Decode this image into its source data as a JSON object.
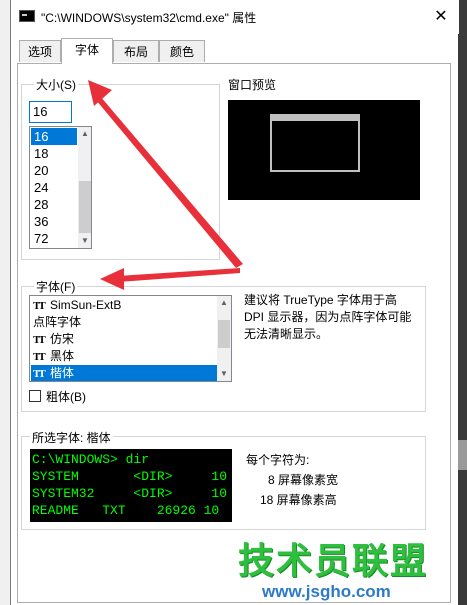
{
  "window": {
    "title": "\"C:\\WINDOWS\\system32\\cmd.exe\" 属性",
    "close_label": "✕"
  },
  "tabs": [
    {
      "label": "选项",
      "active": false
    },
    {
      "label": "字体",
      "active": true
    },
    {
      "label": "布局",
      "active": false
    },
    {
      "label": "颜色",
      "active": false
    }
  ],
  "size": {
    "label": "大小(S)",
    "value": "16",
    "items": [
      "16",
      "18",
      "20",
      "24",
      "28",
      "36",
      "72"
    ],
    "selected": "16"
  },
  "preview": {
    "label": "窗口预览"
  },
  "font": {
    "label": "字体(F)",
    "items": [
      {
        "label": "SimSun-ExtB",
        "icon": "truetype-icon"
      },
      {
        "label": "点阵字体",
        "icon": ""
      },
      {
        "label": "仿宋",
        "icon": "truetype-icon"
      },
      {
        "label": "黑体",
        "icon": "truetype-icon"
      },
      {
        "label": "楷体",
        "icon": "truetype-icon"
      }
    ],
    "selected": "楷体",
    "advice": "建议将 TrueType 字体用于高 DPI 显示器，因为点阵字体可能无法清晰显示。"
  },
  "bold": {
    "label": "粗体(B)",
    "checked": false
  },
  "selected_font": {
    "label": "所选字体: 楷体",
    "sample_lines": [
      "C:\\WINDOWS> dir",
      "SYSTEM       <DIR>     10",
      "SYSTEM32     <DIR>     10",
      "README   TXT    26926 10"
    ]
  },
  "char_info": {
    "heading": "每个字符为:",
    "width": "8 屏幕像素宽",
    "height": "18 屏幕像素高"
  },
  "colors": {
    "accent": "#0078d7",
    "arrow": "#e8303a",
    "console_text": "#00ff00"
  },
  "watermark": {
    "text": "技术员联盟",
    "url": "www.jsgho.com"
  }
}
